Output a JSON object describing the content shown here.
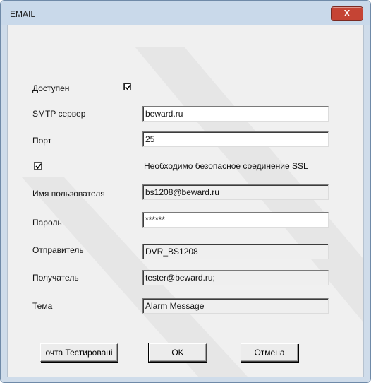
{
  "window": {
    "title": "EMAIL",
    "close_symbol": "X"
  },
  "form": {
    "enabled_label": "Доступен",
    "enabled_checked": true,
    "smtp_label": "SMTP сервер",
    "smtp_value": "beward.ru",
    "port_label": "Порт",
    "port_value": "25",
    "ssl_checked": true,
    "ssl_label": "Необходимо безопасное соединение SSL",
    "username_label": "Имя пользователя",
    "username_value": "bs1208@beward.ru",
    "password_label": "Пароль",
    "password_value": "******",
    "sender_label": "Отправитель",
    "sender_value": "DVR_BS1208",
    "recipient_label": "Получатель",
    "recipient_value": "tester@beward.ru;",
    "subject_label": "Тема",
    "subject_value": "Alarm Message"
  },
  "buttons": {
    "test_label": "очта Тестировані",
    "ok_label": "OK",
    "cancel_label": "Отмена"
  },
  "icons": {
    "close": "close-icon",
    "checkbox": "checkmark-icon"
  }
}
